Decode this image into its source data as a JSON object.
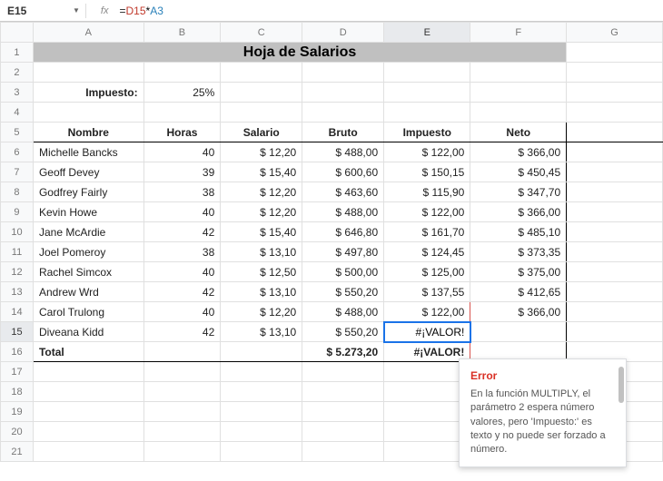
{
  "activeCell": "E15",
  "fxLabel": "fx",
  "formula": {
    "prefix": "=",
    "ref1": "D15",
    "op": "*",
    "ref2": "A3"
  },
  "columns": [
    "A",
    "B",
    "C",
    "D",
    "E",
    "F",
    "G"
  ],
  "selectedColumn": "E",
  "selectedRow": 15,
  "title": "Hoja de Salarios",
  "taxLabel": "Impuesto:",
  "taxRate": "25%",
  "headers": {
    "nombre": "Nombre",
    "horas": "Horas",
    "salario": "Salario",
    "bruto": "Bruto",
    "impuesto": "Impuesto",
    "neto": "Neto"
  },
  "rows": [
    {
      "nombre": "Michelle Bancks",
      "horas": "40",
      "salario": "$ 12,20",
      "bruto": "$ 488,00",
      "impuesto": "$ 122,00",
      "neto": "$ 366,00"
    },
    {
      "nombre": "Geoff Devey",
      "horas": "39",
      "salario": "$ 15,40",
      "bruto": "$ 600,60",
      "impuesto": "$ 150,15",
      "neto": "$ 450,45"
    },
    {
      "nombre": "Godfrey Fairly",
      "horas": "38",
      "salario": "$ 12,20",
      "bruto": "$ 463,60",
      "impuesto": "$ 115,90",
      "neto": "$ 347,70"
    },
    {
      "nombre": "Kevin Howe",
      "horas": "40",
      "salario": "$ 12,20",
      "bruto": "$ 488,00",
      "impuesto": "$ 122,00",
      "neto": "$ 366,00"
    },
    {
      "nombre": "Jane McArdie",
      "horas": "42",
      "salario": "$ 15,40",
      "bruto": "$ 646,80",
      "impuesto": "$ 161,70",
      "neto": "$ 485,10"
    },
    {
      "nombre": "Joel Pomeroy",
      "horas": "38",
      "salario": "$ 13,10",
      "bruto": "$ 497,80",
      "impuesto": "$ 124,45",
      "neto": "$ 373,35"
    },
    {
      "nombre": "Rachel Simcox",
      "horas": "40",
      "salario": "$ 12,50",
      "bruto": "$ 500,00",
      "impuesto": "$ 125,00",
      "neto": "$ 375,00"
    },
    {
      "nombre": "Andrew Wrd",
      "horas": "42",
      "salario": "$ 13,10",
      "bruto": "$ 550,20",
      "impuesto": "$ 137,55",
      "neto": "$ 412,65"
    },
    {
      "nombre": "Carol Trulong",
      "horas": "40",
      "salario": "$ 12,20",
      "bruto": "$ 488,00",
      "impuesto": "$ 122,00",
      "neto": "$ 366,00"
    },
    {
      "nombre": "Diveana Kidd",
      "horas": "42",
      "salario": "$ 13,10",
      "bruto": "$ 550,20",
      "impuesto": "#¡VALOR!",
      "neto": ""
    }
  ],
  "total": {
    "label": "Total",
    "bruto": "$ 5.273,20",
    "impuesto": "#¡VALOR!",
    "neto": ""
  },
  "error": {
    "title": "Error",
    "body": "En la función MULTIPLY, el parámetro 2 espera número valores, pero 'Impuesto:' es texto y no puede ser forzado a número."
  }
}
